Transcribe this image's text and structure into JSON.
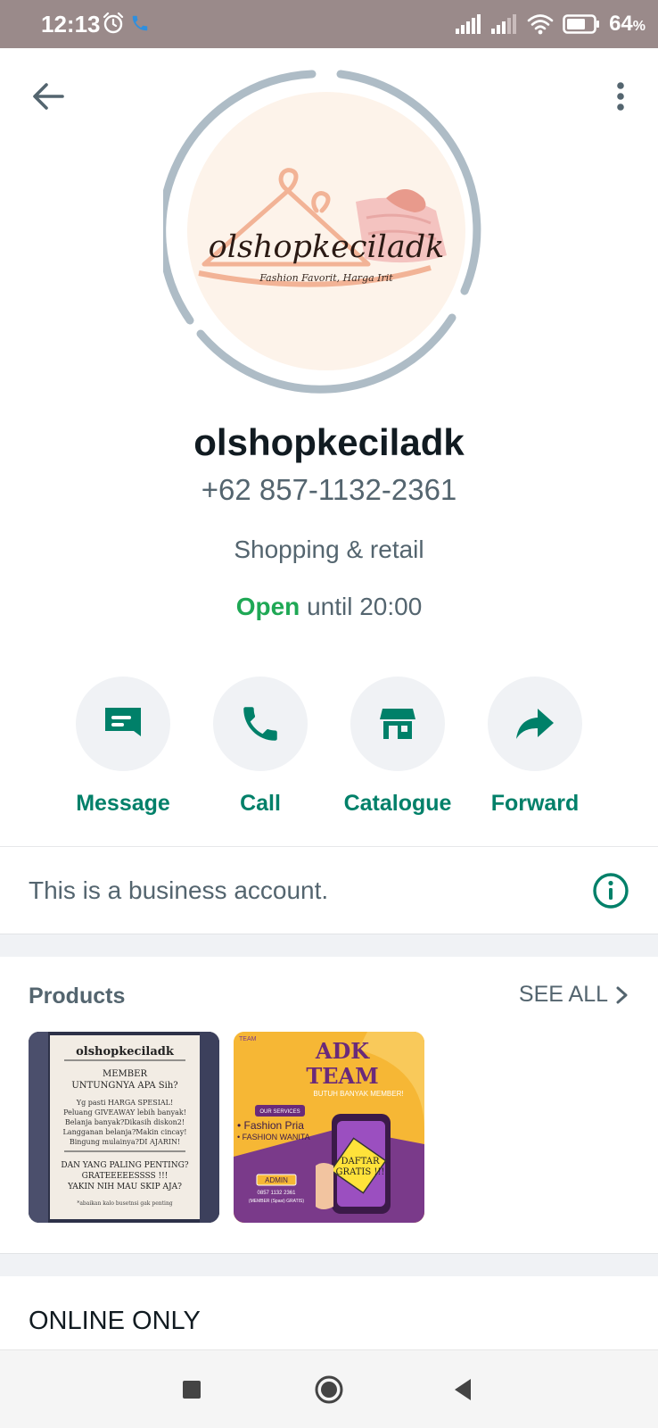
{
  "status_bar": {
    "time": "12:13",
    "battery": "64",
    "battery_unit": "%",
    "icons": [
      "alarm-icon",
      "phone-call-icon",
      "signal-icon",
      "signal-icon",
      "wifi-icon",
      "battery-icon"
    ]
  },
  "toolbar": {
    "back_icon": "arrow-left-icon",
    "menu_icon": "more-vertical-icon"
  },
  "avatar": {
    "logo_text": "olshopkeciladk",
    "tagline": "Fashion Favorit, Harga Irit"
  },
  "profile": {
    "name": "olshopkeciladk",
    "phone": "+62 857-1132-2361",
    "category": "Shopping & retail",
    "hours_status": "Open",
    "hours_detail": "until 20:00"
  },
  "actions": [
    {
      "label": "Message",
      "icon": "message-icon"
    },
    {
      "label": "Call",
      "icon": "phone-icon"
    },
    {
      "label": "Catalogue",
      "icon": "store-icon"
    },
    {
      "label": "Forward",
      "icon": "forward-icon"
    }
  ],
  "business_notice": {
    "text": "This is a business account.",
    "icon": "info-icon"
  },
  "products": {
    "title": "Products",
    "see_all": "SEE ALL",
    "items": [
      {
        "brand": "olshopkeciladk",
        "line1": "MEMBER",
        "line2": "UNTUNGNYA APA Sih?",
        "body1": "Yg pasti HARGA SPESIAL!",
        "body2": "Peluang GIVEAWAY lebih banyak!",
        "body3": "Belanja banyak?Dikasih diskon2!",
        "body4": "Langganan belanja?Makin cincay!",
        "body5": "Bingung mulainya?DI AJARIN!",
        "cta1": "DAN YANG PALING PENTING?",
        "cta2": "GRATEEEEESSSS !!!",
        "cta3": "YAKIN NIH MAU SKIP AJA?",
        "note": "*abaikan kalo busetnsi gak penting"
      },
      {
        "corner": "TEAM",
        "title1": "ADK",
        "title2": "TEAM",
        "subtitle": "BUTUH BANYAK MEMBER!",
        "services_label": "OUR SERVICES",
        "service1": "• Fashion Pria",
        "service2": "• FASHION WANITA",
        "admin_label": "ADMIN",
        "admin_phone": "0857 1132 2361",
        "admin_note": "(MEMBER (Spasi) GRATIS)",
        "badge1": "DAFTAR",
        "badge2": "GRATIS !!!"
      }
    ]
  },
  "about": {
    "text": "ONLINE ONLY"
  },
  "colors": {
    "accent": "#008069",
    "open_green": "#1fa855",
    "status_bar": "#9a8a8a",
    "ring": "#aebcc6"
  },
  "nav": {
    "icons": [
      "recents-square-icon",
      "home-circle-icon",
      "back-triangle-icon"
    ]
  }
}
